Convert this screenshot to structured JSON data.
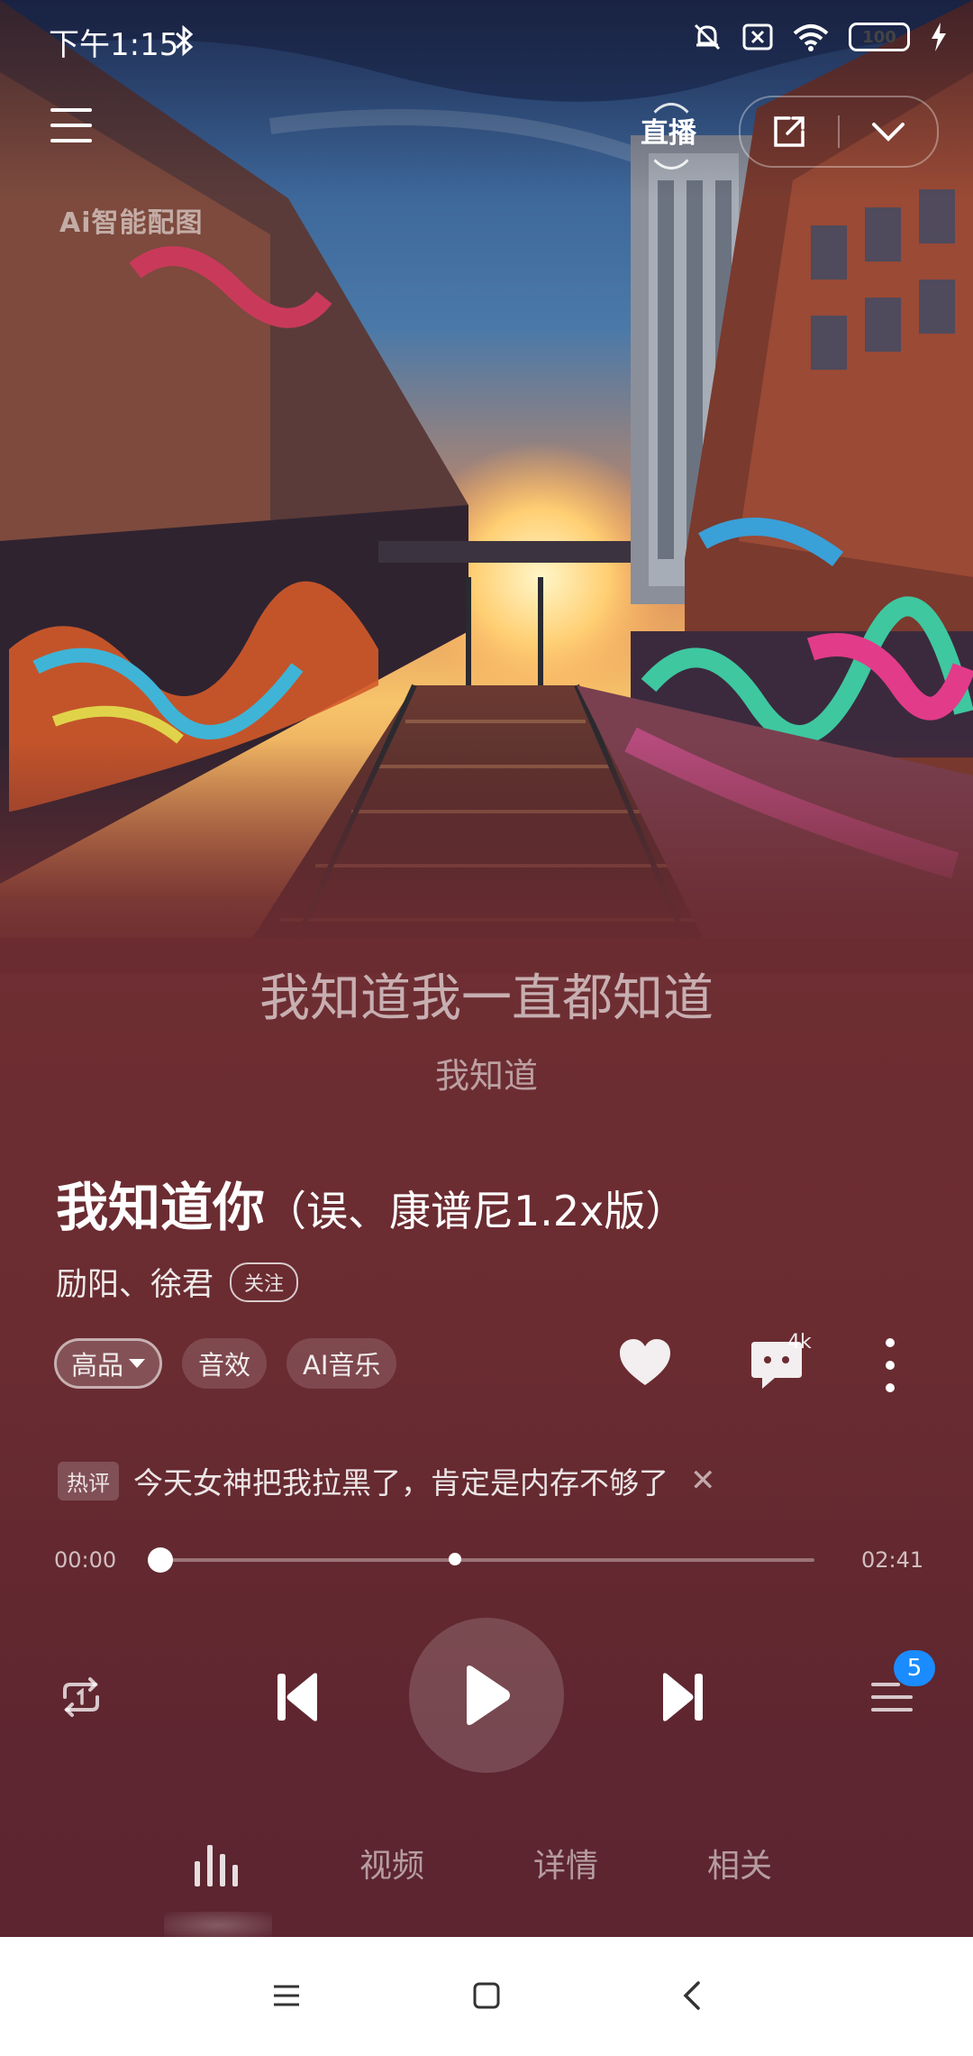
{
  "status_bar": {
    "time": "下午1:15",
    "battery": "100"
  },
  "header": {
    "ai_art_label": "Ai智能配图",
    "live_label": "直播"
  },
  "lyrics": {
    "current": "我知道我一直都知道",
    "next": "我知道"
  },
  "song": {
    "title": "我知道你",
    "version": "（误、康谱尼1.2x版）",
    "artists": "励阳、徐君",
    "follow_label": "关注"
  },
  "chips": [
    {
      "label": "高品",
      "active": true
    },
    {
      "label": "音效",
      "active": false
    },
    {
      "label": "AI音乐",
      "active": false
    }
  ],
  "actions": {
    "comment_count": "4k"
  },
  "hot_comment": {
    "tag": "热评",
    "text": "今天女神把我拉黑了，肯定是内存不够了",
    "close": "✕"
  },
  "progress": {
    "current_time": "00:00",
    "total_time": "02:41",
    "played_fraction": 0.0,
    "marker_fraction": 0.45
  },
  "queue": {
    "badge": "5"
  },
  "tabs": [
    {
      "label": "视频"
    },
    {
      "label": "详情"
    },
    {
      "label": "相关"
    }
  ],
  "colors": {
    "background": "#6a2c31",
    "badge_blue": "#1a8cff",
    "nav_bar": "#ffffff"
  }
}
